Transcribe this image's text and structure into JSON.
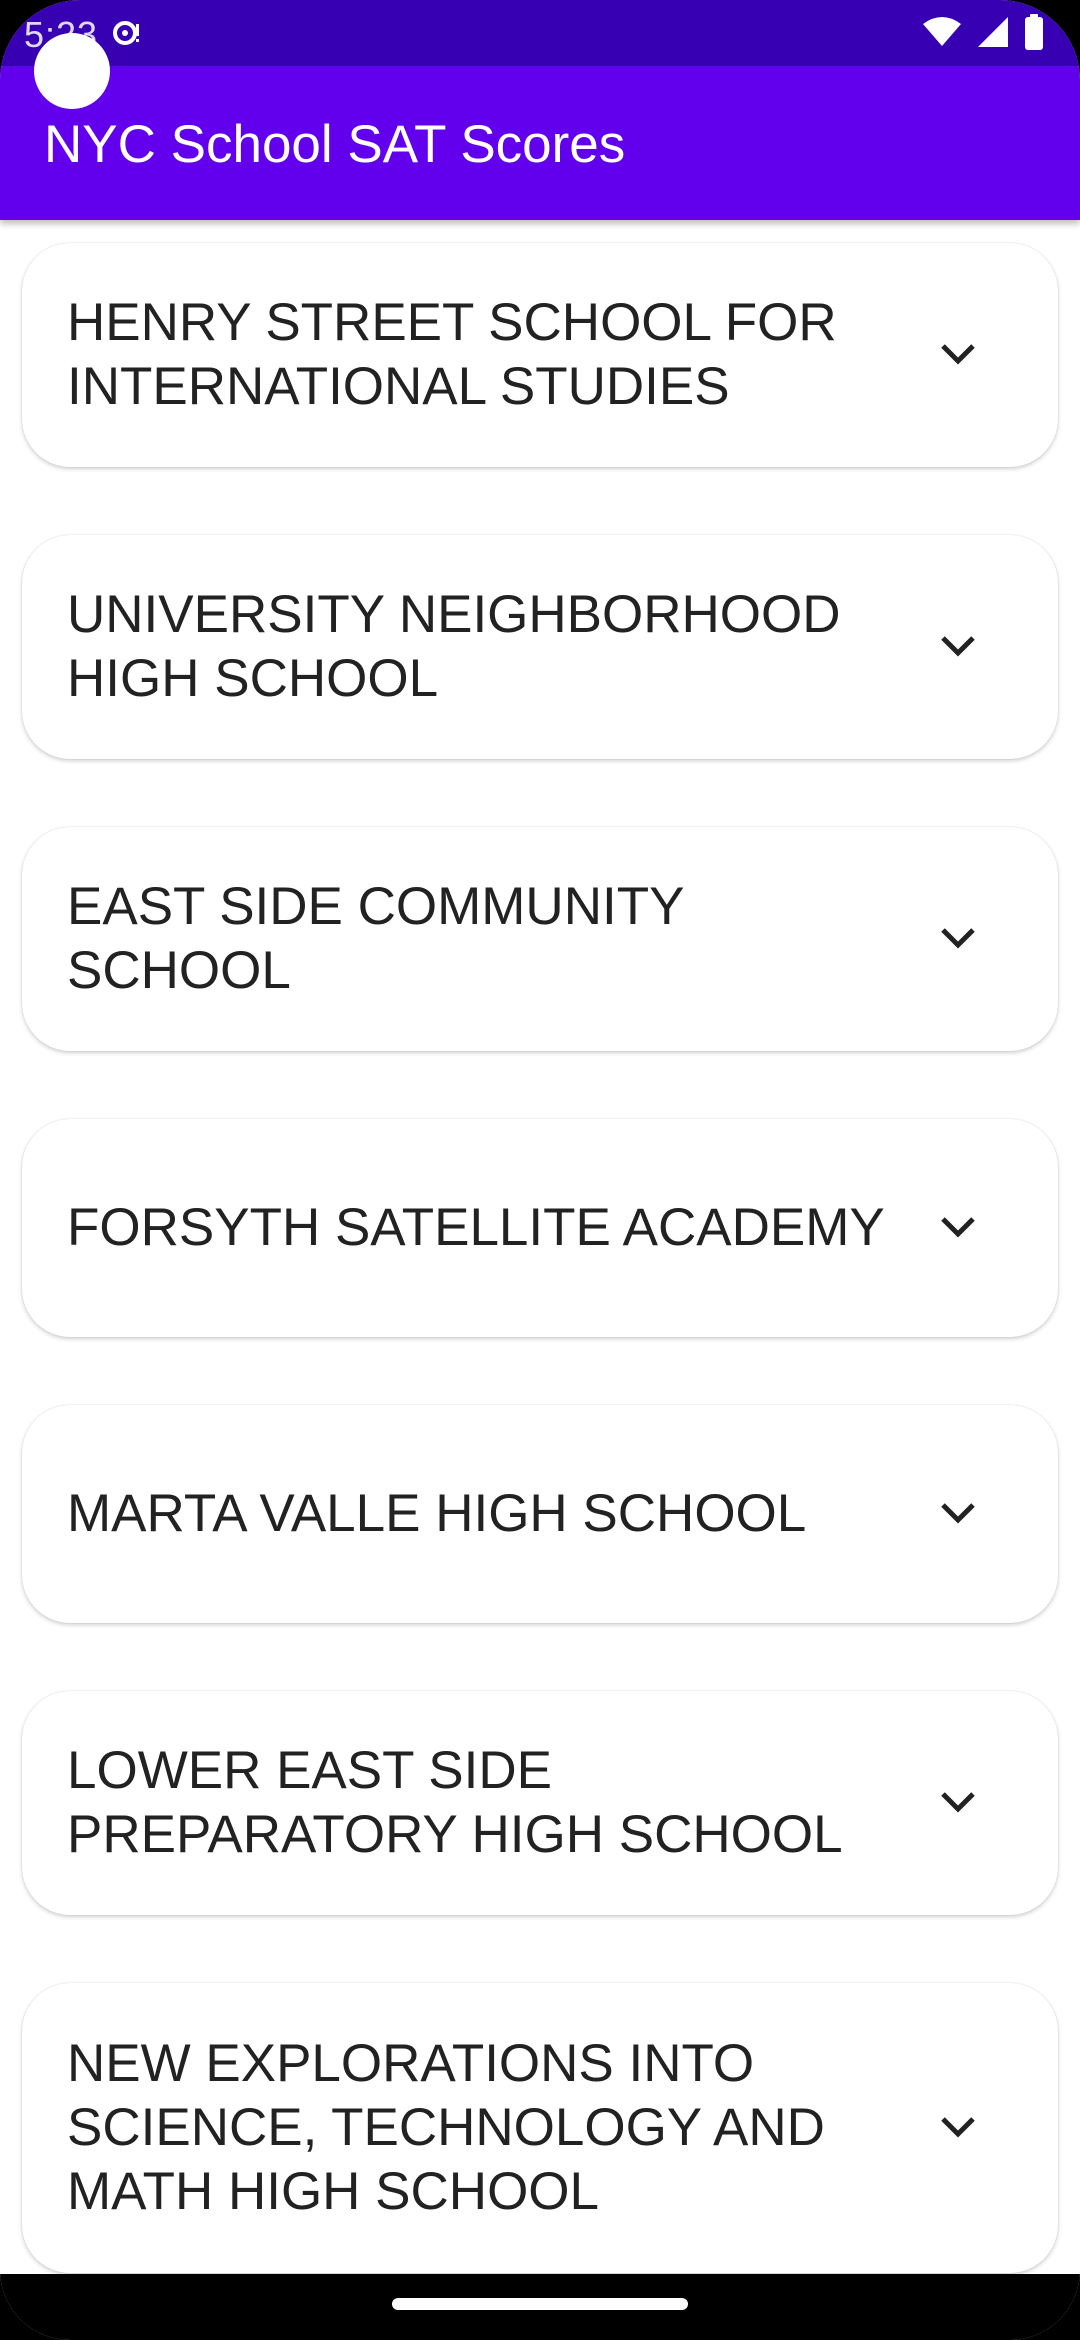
{
  "status_bar": {
    "time": "5:23",
    "icons": [
      "notification-icon",
      "wifi-icon",
      "signal-icon",
      "battery-icon"
    ]
  },
  "app_bar": {
    "title": "NYC School SAT Scores"
  },
  "schools": [
    {
      "name": "HENRY STREET SCHOOL FOR INTERNATIONAL STUDIES"
    },
    {
      "name": "UNIVERSITY NEIGHBORHOOD HIGH SCHOOL"
    },
    {
      "name": "EAST SIDE COMMUNITY SCHOOL"
    },
    {
      "name": "FORSYTH SATELLITE ACADEMY"
    },
    {
      "name": "MARTA VALLE HIGH SCHOOL"
    },
    {
      "name": "LOWER EAST SIDE PREPARATORY HIGH SCHOOL"
    },
    {
      "name": "NEW EXPLORATIONS INTO SCIENCE, TECHNOLOGY AND MATH HIGH SCHOOL"
    }
  ],
  "colors": {
    "status_bar": "#3700b3",
    "app_bar": "#6200ee",
    "card_background": "#ffffff",
    "text": "#222222"
  }
}
